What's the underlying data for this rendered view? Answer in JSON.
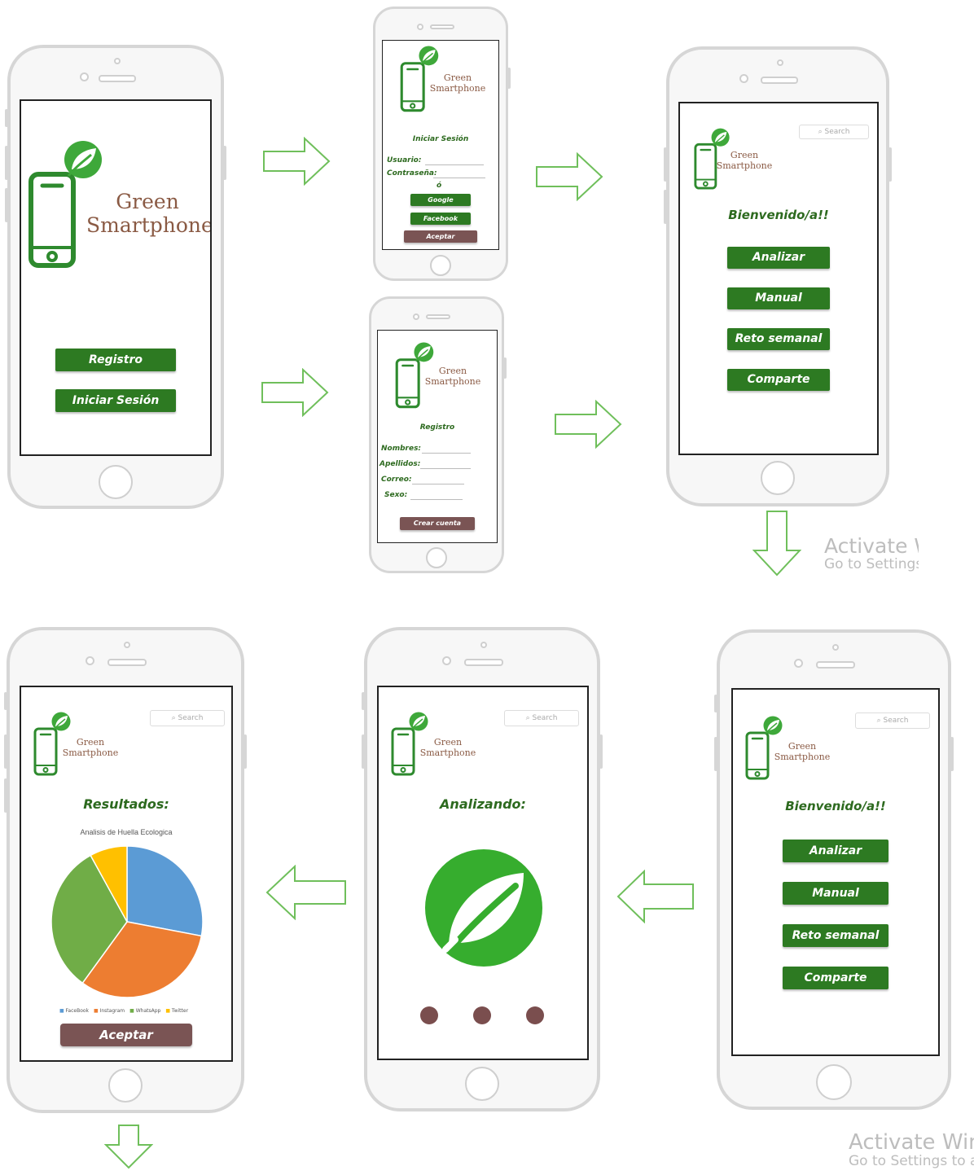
{
  "brand": {
    "line1": "Green",
    "line2": "Smartphone"
  },
  "search_placeholder": "Search",
  "splash": {
    "register_label": "Registro",
    "login_label": "Iniciar Sesión"
  },
  "login": {
    "heading": "Iniciar Sesión",
    "user_label": "Usuario:",
    "password_label": "Contraseña:",
    "or_label": "ó",
    "google_label": "Google",
    "facebook_label": "Facebook",
    "accept_label": "Aceptar"
  },
  "register": {
    "heading": "Registro",
    "names_label": "Nombres:",
    "surnames_label": "Apellidos:",
    "email_label": "Correo:",
    "sex_label": "Sexo:",
    "create_label": "Crear cuenta"
  },
  "home": {
    "welcome": "Bienvenido/a!!",
    "analyze_label": "Analizar",
    "manual_label": "Manual",
    "challenge_label": "Reto semanal",
    "share_label": "Comparte"
  },
  "analyzing": {
    "heading": "Analizando:"
  },
  "results": {
    "heading": "Resultados:",
    "accept_label": "Aceptar"
  },
  "chart_data": {
    "type": "pie",
    "title": "Analisis de Huella Ecologica",
    "categories": [
      "FaceBook",
      "Instagram",
      "WhatsApp",
      "Twitter"
    ],
    "values": [
      28,
      32,
      32,
      8
    ],
    "colors": [
      "#5b9bd5",
      "#ed7d31",
      "#70ad47",
      "#ffc000"
    ],
    "legend_position": "bottom"
  },
  "watermark": {
    "top_line1": "Activate W",
    "top_line2": "Go to Settings",
    "bottom_line1": "Activate Windows",
    "bottom_line2": "Go to Settings to activate Windows."
  },
  "colors": {
    "primary_green": "#2d7a22",
    "brown": "#7a5454",
    "logo_green": "#2e9a2e"
  }
}
